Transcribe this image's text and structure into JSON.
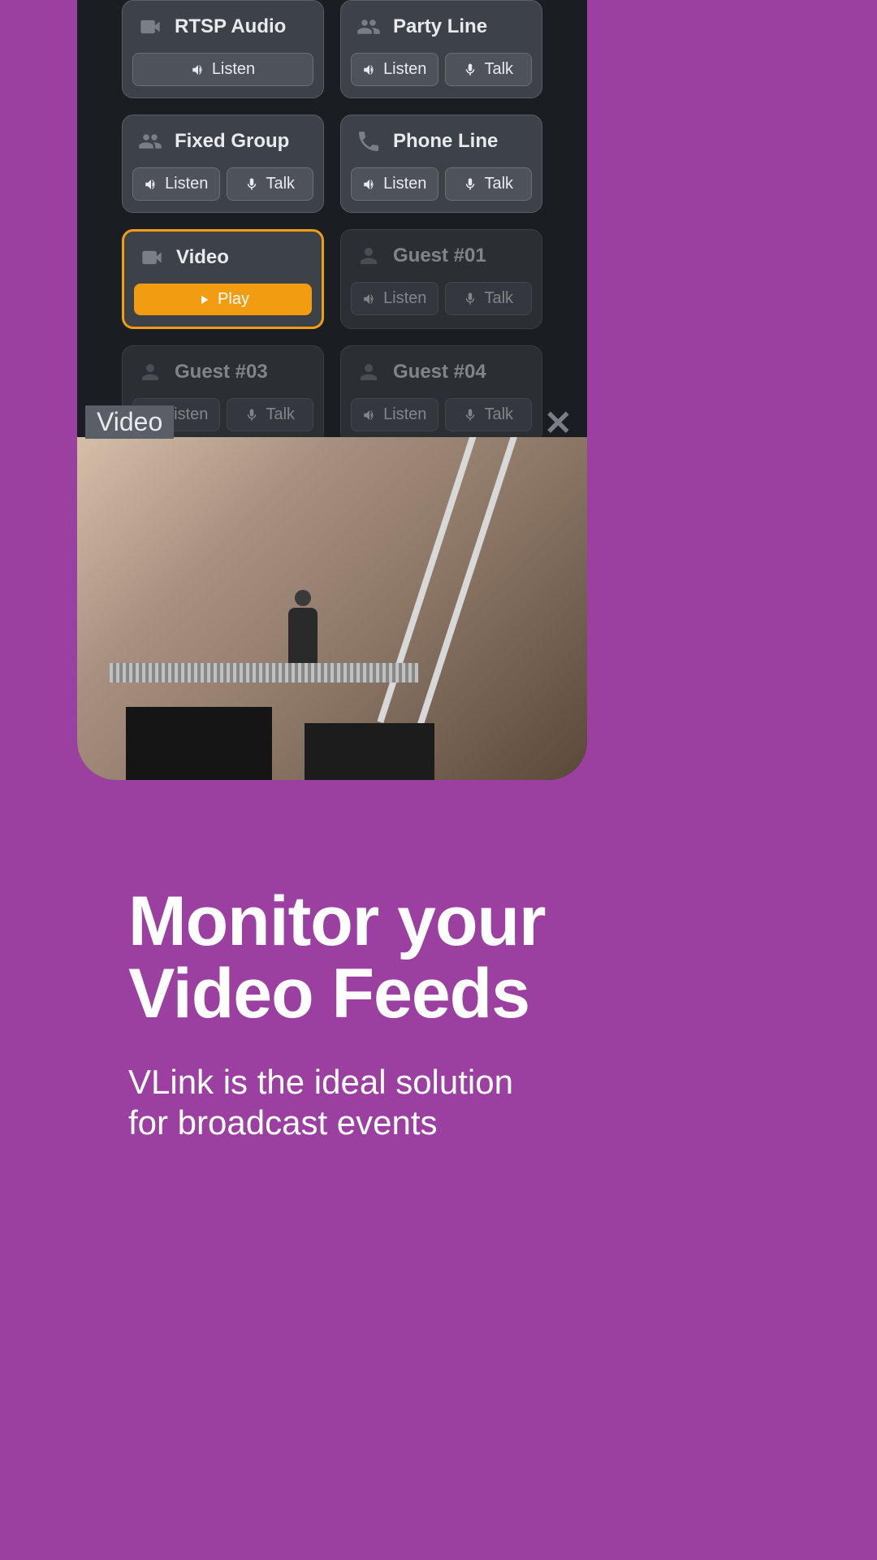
{
  "colors": {
    "bg": "#9b3fa0",
    "accent": "#f29c11",
    "panel": "#1a1d21",
    "card": "#3d4148"
  },
  "hero": {
    "title_line1": "Monitor your",
    "title_line2": "Video Feeds",
    "subtitle_line1": "VLink is the ideal solution",
    "subtitle_line2": "for broadcast events"
  },
  "video_overlay": {
    "label": "Video"
  },
  "buttons": {
    "listen": "Listen",
    "talk": "Talk",
    "play": "Play"
  },
  "cards": [
    {
      "title": "RTSP Audio",
      "icon": "video-camera-icon",
      "buttons": [
        "listen"
      ],
      "state": "normal"
    },
    {
      "title": "Party Line",
      "icon": "group-icon",
      "buttons": [
        "listen",
        "talk"
      ],
      "state": "normal"
    },
    {
      "title": "Fixed Group",
      "icon": "group-icon",
      "buttons": [
        "listen",
        "talk"
      ],
      "state": "normal"
    },
    {
      "title": "Phone Line",
      "icon": "phone-icon",
      "buttons": [
        "listen",
        "talk"
      ],
      "state": "normal"
    },
    {
      "title": "Video",
      "icon": "video-camera-icon",
      "buttons": [
        "play"
      ],
      "state": "selected"
    },
    {
      "title": "Guest #01",
      "icon": "person-icon",
      "buttons": [
        "listen",
        "talk"
      ],
      "state": "dimmed"
    },
    {
      "title": "Guest #03",
      "icon": "person-icon",
      "buttons": [
        "listen",
        "talk"
      ],
      "state": "dimmed"
    },
    {
      "title": "Guest #04",
      "icon": "person-icon",
      "buttons": [
        "listen",
        "talk"
      ],
      "state": "dimmed"
    }
  ]
}
